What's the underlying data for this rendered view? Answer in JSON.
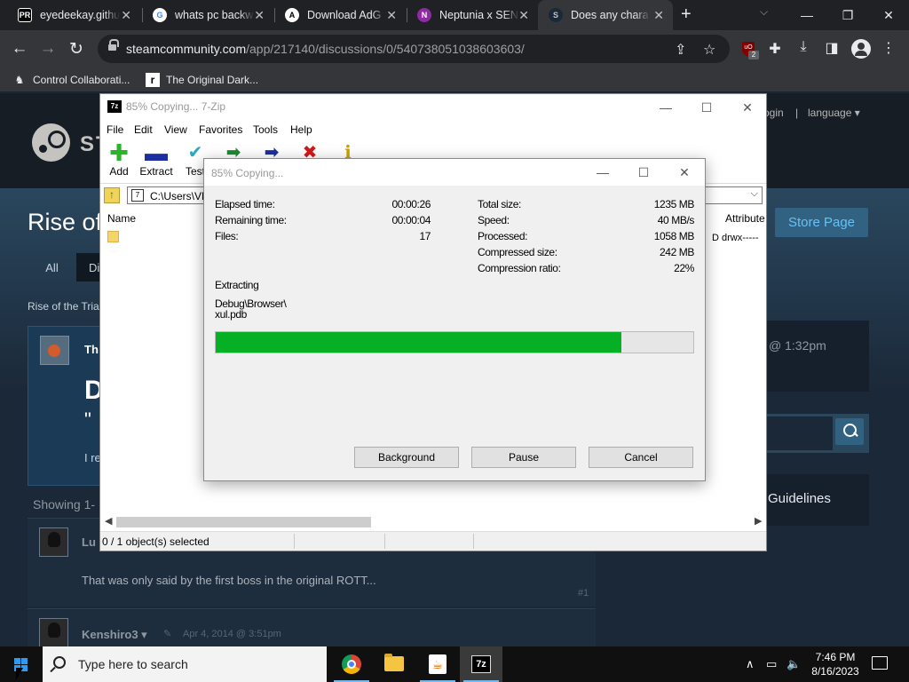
{
  "browser": {
    "tabs": [
      {
        "title": "eyedeekay.githu",
        "favicon": "PR"
      },
      {
        "title": "whats pc backw",
        "favicon": "G"
      },
      {
        "title": "Download AdG",
        "favicon": "A"
      },
      {
        "title": "Neptunia x SEN",
        "favicon": "N"
      },
      {
        "title": "Does any chara",
        "favicon": "S"
      }
    ],
    "active_tab": 4,
    "url_host": "steamcommunity.com",
    "url_path": "/app/217140/discussions/0/540738051038603603/",
    "extension_badge": "2",
    "bookmarks": [
      {
        "label": "Control Collaborati..."
      },
      {
        "label": "The Original Dark..."
      }
    ]
  },
  "steam": {
    "logo_text": "ST",
    "login": "ogin",
    "separator": "|",
    "language": "language ▾",
    "title": "Rise of",
    "tab_all": "All",
    "tab_di": "Di",
    "store_button": "Store Page",
    "breadcrumb": "Rise of the Tria",
    "op_author": "Th",
    "op_big": "D",
    "op_quote": "\"",
    "op_text": "I re",
    "showing": "Showing 1-",
    "side_time": "@ 1:32pm",
    "guidelines": "Guidelines",
    "replies": [
      {
        "author": "Lu",
        "text": "That was only said by the first boss in the original ROTT...",
        "num": "#1"
      },
      {
        "author": "Kenshiro3 ▾",
        "date": "Apr 4, 2014 @ 3:51pm"
      }
    ]
  },
  "sevenzip": {
    "title": "85% Copying... 7-Zip",
    "menu": [
      "File",
      "Edit",
      "View",
      "Favorites",
      "Tools",
      "Help"
    ],
    "toolbar": [
      {
        "label": "Add",
        "icon": "plus-icon"
      },
      {
        "label": "Extract",
        "icon": "minus-icon"
      },
      {
        "label": "Test",
        "icon": "check-icon"
      },
      {
        "label": "",
        "icon": "copy-arrow-icon"
      },
      {
        "label": "",
        "icon": "move-arrow-icon"
      },
      {
        "label": "",
        "icon": "delete-icon"
      },
      {
        "label": "",
        "icon": "info-icon"
      }
    ],
    "path": "C:\\Users\\VM",
    "col_name": "Name",
    "col_attr": "Attribute",
    "attr_value": "D drwx-----",
    "status": "0 / 1 object(s) selected"
  },
  "progress": {
    "title": "85% Copying...",
    "elapsed_label": "Elapsed time:",
    "elapsed": "00:00:26",
    "remaining_label": "Remaining time:",
    "remaining": "00:00:04",
    "files_label": "Files:",
    "files": "17",
    "total_label": "Total size:",
    "total": "1235 MB",
    "speed_label": "Speed:",
    "speed": "40 MB/s",
    "processed_label": "Processed:",
    "processed": "1058 MB",
    "compressed_label": "Compressed size:",
    "compressed": "242 MB",
    "ratio_label": "Compression ratio:",
    "ratio": "22%",
    "action": "Extracting",
    "file_path": "Debug\\Browser\\",
    "file_name": "xul.pdb",
    "percent": 0.85,
    "btn_background": "Background",
    "btn_pause": "Pause",
    "btn_cancel": "Cancel"
  },
  "taskbar": {
    "search_placeholder": "Type here to search",
    "time": "7:46 PM",
    "date": "8/16/2023"
  },
  "colors": {
    "progress_fill": "#06b025",
    "steam_bg": "#1b2838",
    "chrome_frame": "#202124"
  }
}
